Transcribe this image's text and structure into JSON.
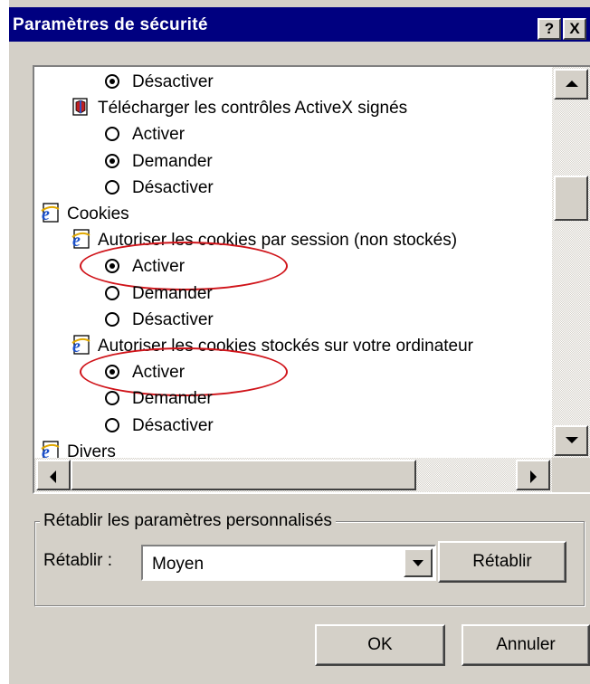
{
  "window": {
    "title": "Paramètres de sécurité",
    "help_label": "?",
    "close_label": "X"
  },
  "tree": [
    {
      "type": "radio",
      "label": "Désactiver",
      "checked": true,
      "indent": 2
    },
    {
      "type": "activex",
      "label": "Télécharger les contrôles ActiveX signés",
      "indent": 1
    },
    {
      "type": "radio",
      "label": "Activer",
      "checked": false,
      "indent": 2
    },
    {
      "type": "radio",
      "label": "Demander",
      "checked": true,
      "indent": 2
    },
    {
      "type": "radio",
      "label": "Désactiver",
      "checked": false,
      "indent": 2
    },
    {
      "type": "ie",
      "label": "Cookies",
      "indent": 0
    },
    {
      "type": "ie",
      "label": "Autoriser les cookies par session (non stockés)",
      "indent": 1
    },
    {
      "type": "radio",
      "label": "Activer",
      "checked": true,
      "indent": 2,
      "annotated": true
    },
    {
      "type": "radio",
      "label": "Demander",
      "checked": false,
      "indent": 2
    },
    {
      "type": "radio",
      "label": "Désactiver",
      "checked": false,
      "indent": 2
    },
    {
      "type": "ie",
      "label": "Autoriser les cookies stockés sur votre ordinateur",
      "indent": 1
    },
    {
      "type": "radio",
      "label": "Activer",
      "checked": true,
      "indent": 2,
      "annotated": true
    },
    {
      "type": "radio",
      "label": "Demander",
      "checked": false,
      "indent": 2
    },
    {
      "type": "radio",
      "label": "Désactiver",
      "checked": false,
      "indent": 2
    },
    {
      "type": "ie",
      "label": "Divers",
      "indent": 0
    }
  ],
  "reset_group": {
    "label": "Rétablir les paramètres personnalisés",
    "field_label": "Rétablir :",
    "select_value": "Moyen",
    "reset_button": "Rétablir"
  },
  "buttons": {
    "ok": "OK",
    "cancel": "Annuler"
  },
  "colors": {
    "titlebar": "#000080",
    "face": "#d4d0c8",
    "annotation": "#d0141a"
  }
}
